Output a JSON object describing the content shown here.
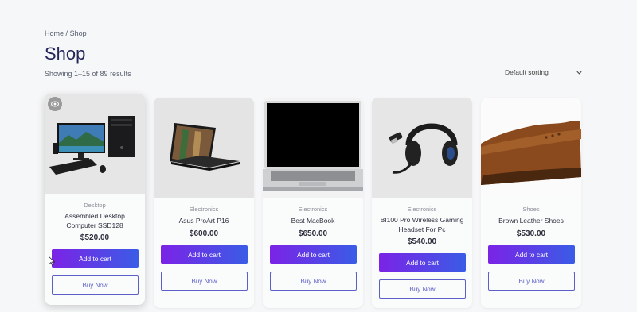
{
  "breadcrumb": {
    "home": "Home",
    "separator": "/",
    "current": "Shop"
  },
  "page": {
    "title": "Shop",
    "result_count": "Showing 1–15 of 89 results"
  },
  "sorting": {
    "selected": "Default sorting"
  },
  "products": [
    {
      "category": "Desktop",
      "name": "Assembled Desktop Computer SSD128",
      "price": "$520.00",
      "add_label": "Add to cart",
      "buy_label": "Buy Now",
      "image_icon": "desktop-computer-image"
    },
    {
      "category": "Electronics",
      "name": "Asus ProArt P16",
      "price": "$600.00",
      "add_label": "Add to cart",
      "buy_label": "Buy Now",
      "image_icon": "laptop-image"
    },
    {
      "category": "Electronics",
      "name": "Best MacBook",
      "price": "$650.00",
      "add_label": "Add to cart",
      "buy_label": "Buy Now",
      "image_icon": "macbook-image"
    },
    {
      "category": "Electronics",
      "name": "BI100 Pro Wireless Gaming Headset For Pc",
      "price": "$540.00",
      "add_label": "Add to cart",
      "buy_label": "Buy Now",
      "image_icon": "headset-image"
    },
    {
      "category": "Shoes",
      "name": "Brown Leather Shoes",
      "price": "$530.00",
      "add_label": "Add to cart",
      "buy_label": "Buy Now",
      "image_icon": "leather-shoes-image"
    }
  ],
  "colors": {
    "button_gradient_start": "#7b23e6",
    "button_gradient_end": "#3a5ce6",
    "buy_border": "#5b5fc7",
    "title": "#24265a"
  }
}
